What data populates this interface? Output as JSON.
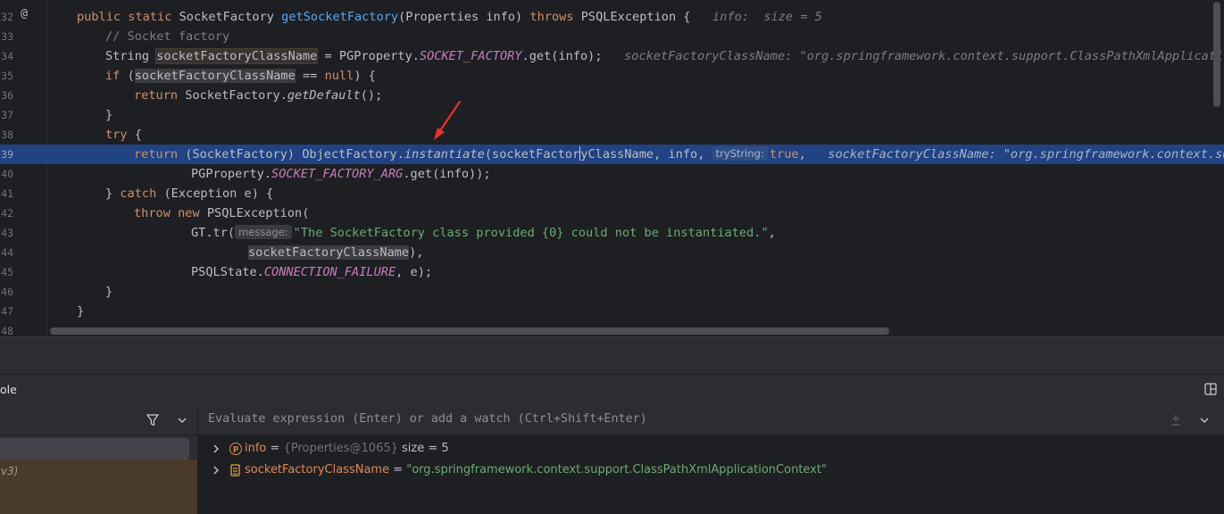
{
  "editor": {
    "line_numbers": [
      "32",
      "33",
      "34",
      "35",
      "36",
      "37",
      "38",
      "39",
      "40",
      "41",
      "42",
      "43",
      "44",
      "45",
      "46",
      "47",
      "48"
    ],
    "active_line": "39",
    "lines": {
      "l32": {
        "kw1": "public static ",
        "type": "SocketFactory ",
        "fn": "getSocketFactory",
        "args": "(Properties info) ",
        "kw2": "throws ",
        "exc": "PSQLException {",
        "hint": "   info:  size = 5"
      },
      "l33": {
        "comment": "// Socket factory"
      },
      "l34": {
        "t1": "String ",
        "var": "socketFactoryClassName",
        "t2": " = PGProperty.",
        "const": "SOCKET_FACTORY",
        "t3": ".get(info);",
        "hint": "   socketFactoryClassName: \"org.springframework.context.support.ClassPathXmlApplicationContext\""
      },
      "l35": {
        "kw": "if ",
        "t1": "(",
        "var": "socketFactoryClassName",
        "t2": " == ",
        "kw2": "null",
        ")": ") {"
      },
      "l36": {
        "kw": "return ",
        "t1": "SocketFactory.",
        "it": "getDefault",
        "t2": "();"
      },
      "l37": {
        "t": "}"
      },
      "l38": {
        "kw": "try ",
        "t": "{"
      },
      "l39": {
        "kw": "return ",
        "t1": "(SocketFactory) ObjectFactory.",
        "it": "instantiate",
        "t2": "(socketFactor",
        "t3": "yClassName, info, ",
        "param": "tryString:",
        "kw2": "true",
        "t4": ",",
        "hint": "   socketFactoryClassName: \"org.springframework.context.support.ClassPathXmlApplicationContext\""
      },
      "l40": {
        "t1": "PGProperty.",
        "const": "SOCKET_FACTORY_ARG",
        "t2": ".get(info));"
      },
      "l41": {
        "t1": "} ",
        "kw": "catch ",
        "t2": "(Exception e) {"
      },
      "l42": {
        "kw": "throw new ",
        "t": "PSQLException("
      },
      "l43": {
        "t1": "GT.tr(",
        "param": "message:",
        "str": "\"The SocketFactory class provided {0} could not be instantiated.\"",
        "t2": ","
      },
      "l44": {
        "var": "socketFactoryClassName",
        "t": "),"
      },
      "l45": {
        "t1": "PSQLState.",
        "const": "CONNECTION_FAILURE",
        "t2": ", e);"
      },
      "l46": {
        "t": "}"
      },
      "l47": {
        "t": "}"
      }
    }
  },
  "debugger": {
    "panel_title": "ole",
    "frame_text": "v3)",
    "eval_placeholder": "Evaluate expression (Enter) or add a watch (Ctrl+Shift+Enter)",
    "variables": [
      {
        "name": "info",
        "eq": " = ",
        "meta": "{Properties@1065}",
        "value": "  size = 5",
        "icon": "p-badge-icon"
      },
      {
        "name": "socketFactoryClassName",
        "eq": " = ",
        "value": "\"org.springframework.context.support.ClassPathXmlApplicationContext\"",
        "icon": "field-icon"
      }
    ]
  },
  "colors": {
    "selection": "#214283",
    "arrow": "#e8322b",
    "keyword": "#cf8e6d",
    "function": "#56a8f5",
    "string": "#6aab73",
    "constant": "#c77dbb"
  }
}
